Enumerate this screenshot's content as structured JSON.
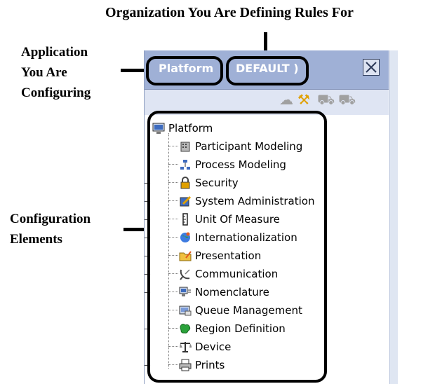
{
  "annotations": {
    "organization": "Organization You Are Defining Rules For",
    "application_line1": "Application",
    "application_line2": "You Are",
    "application_line3": "Configuring",
    "config_line1": "Configuration",
    "config_line2": "Elements"
  },
  "panel": {
    "tab_platform": "Platform",
    "tab_default": "DEFAULT )",
    "close_glyph": "☒"
  },
  "tree": {
    "root": {
      "label": "Platform",
      "icon": "monitor-icon"
    },
    "items": [
      {
        "label": "Participant Modeling",
        "icon": "building-icon",
        "expandable": false
      },
      {
        "label": "Process Modeling",
        "icon": "process-icon",
        "expandable": false
      },
      {
        "label": "Security",
        "icon": "lock-icon",
        "expandable": true
      },
      {
        "label": "System Administration",
        "icon": "edit-icon",
        "expandable": true
      },
      {
        "label": "Unit Of Measure",
        "icon": "ruler-icon",
        "expandable": true
      },
      {
        "label": "Internationalization",
        "icon": "globe-icon",
        "expandable": true
      },
      {
        "label": "Presentation",
        "icon": "folder-icon",
        "expandable": true
      },
      {
        "label": "Communication",
        "icon": "satellite-icon",
        "expandable": true
      },
      {
        "label": "Nomenclature",
        "icon": "monitor-icon",
        "expandable": true
      },
      {
        "label": "Queue Management",
        "icon": "queue-icon",
        "expandable": false
      },
      {
        "label": "Region Definition",
        "icon": "map-icon",
        "expandable": true
      },
      {
        "label": "Device",
        "icon": "scale-icon",
        "expandable": false
      },
      {
        "label": "Prints",
        "icon": "printer-icon",
        "expandable": true
      }
    ]
  }
}
